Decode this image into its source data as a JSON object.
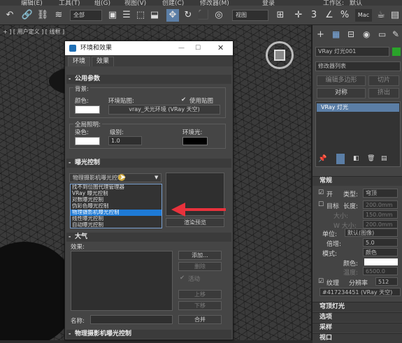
{
  "menubar": {
    "items": [
      "编辑(E)",
      "工具(T)",
      "组(G)",
      "视图(V)",
      "创建(C)",
      "修改器(M)",
      "登录",
      "工作区:",
      "默认"
    ]
  },
  "toolbar": {
    "filter_select": "全部",
    "view_select": "视图"
  },
  "viewport": {
    "label": "+ ] [ 用户定义 ] [ 线框 ]"
  },
  "dialog": {
    "title": "环境和效果",
    "tabs": [
      "环境",
      "效果"
    ],
    "common": {
      "header": "公用参数",
      "background_label": "背景:",
      "color_label": "颜色:",
      "env_map_label": "环境贴图:",
      "use_map_label": "使用贴图",
      "env_map_value": "vray_天光环境 (VRay 天空)",
      "global_light_label": "全局照明:",
      "tint_label": "染色:",
      "level_label": "级别:",
      "level_value": "1.0",
      "ambient_label": "环境光:"
    },
    "exposure": {
      "header": "曝光控制",
      "selected": "物理摄影机曝光控制",
      "options": [
        "找不到位图代理管理器",
        "VRay 曝光控制",
        "对数曝光控制",
        "伪彩色曝光控制",
        "物理摄影机曝光控制",
        "线性曝光控制",
        "自动曝光控制"
      ],
      "selected_index": 4,
      "render_preview": "渲染预览"
    },
    "atmosphere": {
      "header": "大气",
      "effects_label": "效果:",
      "add": "添加...",
      "delete": "删除",
      "active": "活动",
      "move_up": "上移",
      "move_down": "下移",
      "name_label": "名称:",
      "merge": "合并"
    },
    "bottom_header": "物理摄影机曝光控制"
  },
  "rpanel": {
    "object_name": "VRay 灯光001",
    "modifier_list": "修改器列表",
    "btn_edit_poly": "编辑多边形",
    "btn_slice": "切片",
    "btn_symmetry": "对称",
    "btn_extrude": "挤出",
    "stack_item": "VRay 灯光",
    "general": {
      "header": "常规",
      "on_label": "开",
      "type_label": "类型:",
      "type_value": "穹顶",
      "target_label": "目标",
      "length_label": "长度:",
      "length_value": "200.0mm",
      "l_label": "大小:",
      "l_value": "150.0mm",
      "w_label": "W 大小:",
      "w_value": "200.0mm",
      "units_label": "单位:",
      "units_value": "默认(图像)",
      "multiplier_label": "倍增:",
      "multiplier_value": "5.0",
      "mode_label": "模式:",
      "mode_value": "颜色",
      "color_label": "颜色:",
      "temp_label": "温度:",
      "temp_value": "6500.0",
      "texture_label": "纹理",
      "resolution_label": "分辨率",
      "resolution_value": "512",
      "map_value": "#417234451 (VRay 天空)"
    },
    "sections": [
      "穹顶灯光",
      "选项",
      "采样",
      "视口"
    ]
  },
  "colors": {
    "dialog_bg": "#454545",
    "selection": "#1e7ad6",
    "arrow": "#e8323c"
  }
}
